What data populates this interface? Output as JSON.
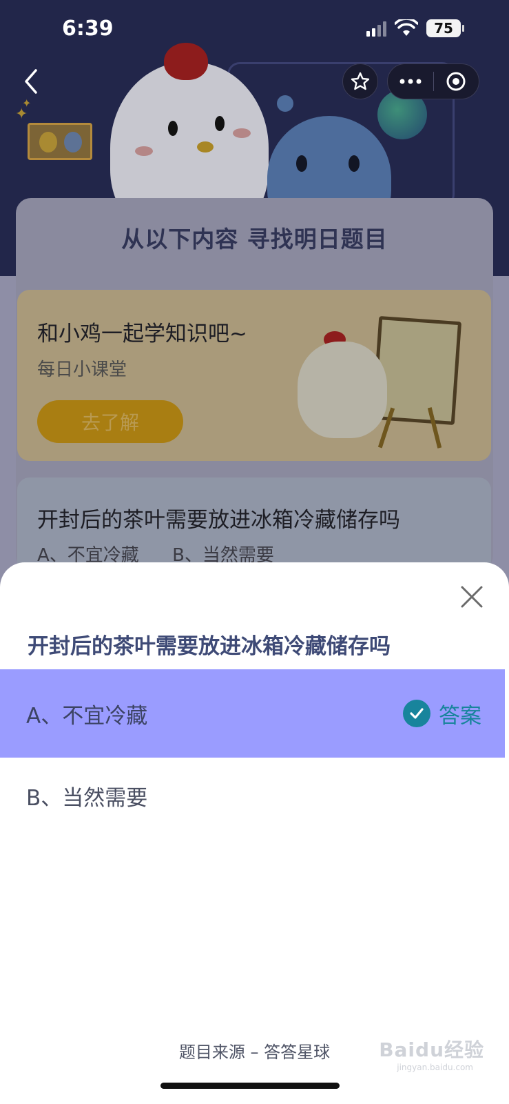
{
  "status_bar": {
    "time": "6:39",
    "battery": "75"
  },
  "header": {
    "icons": [
      "back-icon",
      "star-icon",
      "more-icon",
      "target-icon"
    ]
  },
  "background": {
    "section_title": "从以下内容 寻找明日题目",
    "lesson_card": {
      "title": "和小鸡一起学知识吧~",
      "subtitle": "每日小课堂",
      "button": "去了解"
    },
    "question_card": {
      "question": "开封后的茶叶需要放进冰箱冷藏储存吗",
      "option_a": "A、不宜冷藏",
      "option_b": "B、当然需要"
    }
  },
  "sheet": {
    "question": "开封后的茶叶需要放进冰箱冷藏储存吗",
    "options": [
      {
        "label": "A、不宜冷藏",
        "correct": true
      },
      {
        "label": "B、当然需要",
        "correct": false
      }
    ],
    "answer_label": "答案",
    "source": "题目来源 – 答答星球"
  },
  "watermark": {
    "text": "Baidu经验",
    "url": "jingyan.baidu.com"
  },
  "colors": {
    "correct_bg": "#9a9cff",
    "answer_accent": "#18849c",
    "question_text": "#3e4a76"
  }
}
